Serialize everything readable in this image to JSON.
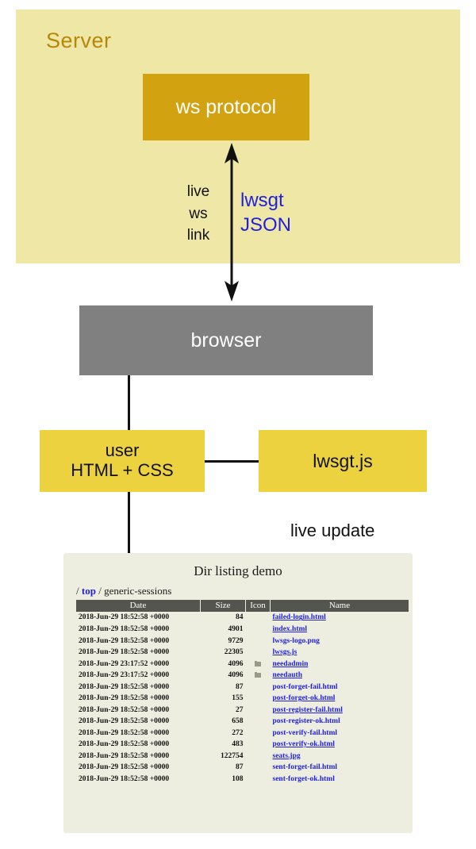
{
  "diagram": {
    "server_region_label": "Server",
    "ws_protocol_label": "ws protocol",
    "link_label_lines": "live\nws\nlink",
    "link_label_line1": "live",
    "link_label_line2": "ws",
    "link_label_line3": "link",
    "protocol_name_line1": "lwsgt",
    "protocol_name_line2": "JSON",
    "browser_label": "browser",
    "user_label_line1": "user",
    "user_label_line2": "HTML + CSS",
    "lwsgtjs_label": "lwsgt.js",
    "live_update_label": "live update",
    "colors": {
      "server_bg": "#efe7a6",
      "server_text": "#b5870b",
      "ws_protocol_bg": "#d3a210",
      "browser_bg": "#808080",
      "user_bg": "#ecd23f",
      "lwsgtjs_bg": "#ecd23f",
      "link_text": "#1f1fdd",
      "panel_bg": "#eeeee0"
    }
  },
  "dir_listing": {
    "title": "Dir listing demo",
    "breadcrumb": {
      "leading_sep": "/",
      "root_label": "top",
      "middle_sep": "/",
      "current_label": "generic-sessions"
    },
    "columns": [
      "Date",
      "Size",
      "Icon",
      "Name"
    ],
    "rows": [
      {
        "date": "2018-Jun-29 18:52:58 +0000",
        "size": "84",
        "icon": "",
        "name": "failed-login.html",
        "underlined": true
      },
      {
        "date": "2018-Jun-29 18:52:58 +0000",
        "size": "4901",
        "icon": "",
        "name": "index.html",
        "underlined": true
      },
      {
        "date": "2018-Jun-29 18:52:58 +0000",
        "size": "9729",
        "icon": "",
        "name": "lwsgs-logo.png",
        "underlined": false
      },
      {
        "date": "2018-Jun-29 18:52:58 +0000",
        "size": "22305",
        "icon": "",
        "name": "lwsgs.js",
        "underlined": true
      },
      {
        "date": "2018-Jun-29 23:17:52 +0000",
        "size": "4096",
        "icon": "folder-icon",
        "name": "needadmin",
        "underlined": true
      },
      {
        "date": "2018-Jun-29 23:17:52 +0000",
        "size": "4096",
        "icon": "folder-icon",
        "name": "needauth",
        "underlined": true
      },
      {
        "date": "2018-Jun-29 18:52:58 +0000",
        "size": "87",
        "icon": "",
        "name": "post-forget-fail.html",
        "underlined": false
      },
      {
        "date": "2018-Jun-29 18:52:58 +0000",
        "size": "155",
        "icon": "",
        "name": "post-forget-ok.html",
        "underlined": true
      },
      {
        "date": "2018-Jun-29 18:52:58 +0000",
        "size": "27",
        "icon": "",
        "name": "post-register-fail.html",
        "underlined": true
      },
      {
        "date": "2018-Jun-29 18:52:58 +0000",
        "size": "658",
        "icon": "",
        "name": "post-register-ok.html",
        "underlined": false
      },
      {
        "date": "2018-Jun-29 18:52:58 +0000",
        "size": "272",
        "icon": "",
        "name": "post-verify-fail.html",
        "underlined": false
      },
      {
        "date": "2018-Jun-29 18:52:58 +0000",
        "size": "483",
        "icon": "",
        "name": "post-verify-ok.html",
        "underlined": true
      },
      {
        "date": "2018-Jun-29 18:52:58 +0000",
        "size": "122754",
        "icon": "",
        "name": "seats.jpg",
        "underlined": true
      },
      {
        "date": "2018-Jun-29 18:52:58 +0000",
        "size": "87",
        "icon": "",
        "name": "sent-forget-fail.html",
        "underlined": false
      },
      {
        "date": "2018-Jun-29 18:52:58 +0000",
        "size": "108",
        "icon": "",
        "name": "sent-forget-ok.html",
        "underlined": false
      }
    ]
  }
}
